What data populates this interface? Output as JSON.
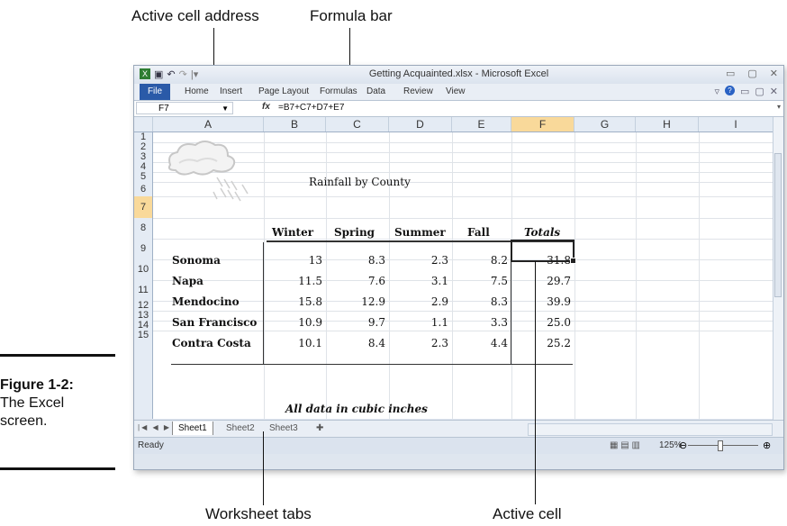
{
  "callouts": {
    "active_cell_address": "Active cell address",
    "formula_bar": "Formula bar",
    "worksheet_tabs": "Worksheet tabs",
    "active_cell": "Active cell"
  },
  "figure": {
    "number": "Figure 1-2:",
    "caption": "The Excel screen."
  },
  "window": {
    "title": "Getting Acquainted.xlsx - Microsoft Excel"
  },
  "ribbon": {
    "tabs": [
      "File",
      "Home",
      "Insert",
      "Page Layout",
      "Formulas",
      "Data",
      "Review",
      "View"
    ]
  },
  "formula_bar": {
    "name_box": "F7",
    "fx": "fx",
    "formula": "=B7+C7+D7+E7"
  },
  "columns": [
    "A",
    "B",
    "C",
    "D",
    "E",
    "F",
    "G",
    "H",
    "I"
  ],
  "rows": [
    "1",
    "2",
    "3",
    "4",
    "5",
    "6",
    "7",
    "8",
    "9",
    "10",
    "11",
    "12",
    "13",
    "14",
    "15"
  ],
  "sheet": {
    "title": "Rainfall by County",
    "headers": [
      "Winter",
      "Spring",
      "Summer",
      "Fall",
      "Totals"
    ],
    "data": [
      {
        "county": "Sonoma",
        "values": [
          "13",
          "8.3",
          "2.3",
          "8.2",
          "31.8"
        ]
      },
      {
        "county": "Napa",
        "values": [
          "11.5",
          "7.6",
          "3.1",
          "7.5",
          "29.7"
        ]
      },
      {
        "county": "Mendocino",
        "values": [
          "15.8",
          "12.9",
          "2.9",
          "8.3",
          "39.9"
        ]
      },
      {
        "county": "San Francisco",
        "values": [
          "10.9",
          "9.7",
          "1.1",
          "3.3",
          "25.0"
        ]
      },
      {
        "county": "Contra Costa",
        "values": [
          "10.1",
          "8.4",
          "2.3",
          "4.4",
          "25.2"
        ]
      }
    ],
    "footnote": "All data in cubic inches"
  },
  "sheet_tabs": [
    "Sheet1",
    "Sheet2",
    "Sheet3"
  ],
  "status": {
    "mode": "Ready",
    "zoom": "125%"
  }
}
